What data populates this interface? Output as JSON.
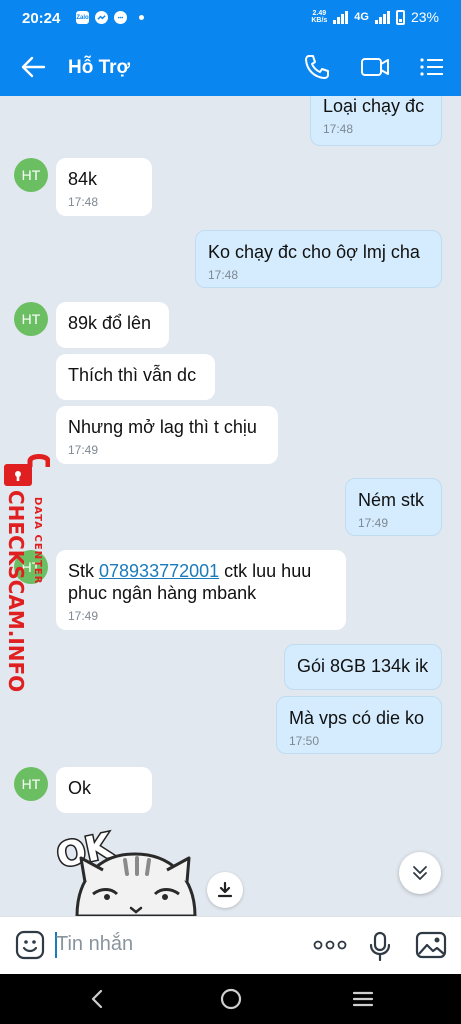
{
  "status_bar": {
    "time": "20:24",
    "notification_icons": [
      "zalo-icon",
      "messenger-icon",
      "chat-icon",
      "dot-icon"
    ],
    "net_speed_value": "2.49",
    "net_speed_unit": "KB/s",
    "network": "4G",
    "battery": "23%"
  },
  "header": {
    "title": "Hỗ Trợ",
    "actions": [
      "phone-icon",
      "video-call-icon",
      "menu-icon"
    ]
  },
  "messages": [
    {
      "dir": "out",
      "text": "Loại chạy đc",
      "time": "17:48"
    },
    {
      "dir": "in",
      "text": "84k",
      "time": "17:48",
      "avatar": "HT"
    },
    {
      "dir": "out",
      "text": "Ko chạy đc cho ôợ lmj cha",
      "time": "17:48"
    },
    {
      "dir": "in",
      "text": "89k đổ lên",
      "avatar": "HT"
    },
    {
      "dir": "in",
      "text": "Thích thì vẫn dc"
    },
    {
      "dir": "in",
      "text": "Nhưng mở lag thì t chịu",
      "time": "17:49"
    },
    {
      "dir": "out",
      "text": "Ném stk",
      "time": "17:49"
    },
    {
      "dir": "in",
      "text_prefix": "Stk ",
      "link": "078933772001",
      "text_suffix": " ctk luu huu",
      "text_line2": "phuc ngân hàng mbank",
      "time": "17:49",
      "avatar": "HT"
    },
    {
      "dir": "out",
      "text": "Gói 8GB 134k ik"
    },
    {
      "dir": "out",
      "text": "Mà vps có die ko",
      "time": "17:50"
    },
    {
      "dir": "in",
      "text": "Ok",
      "avatar": "HT"
    }
  ],
  "sticker": {
    "caption": "OK",
    "icon": "cat-sticker"
  },
  "watermark": {
    "brand": "CHECKSCAM.INFO",
    "sub": "DATA CENTER"
  },
  "composer": {
    "placeholder": "Tin nhắn"
  },
  "colors": {
    "accent": "#0a86f0",
    "outgoing_bubble": "#d4ecfd",
    "incoming_bubble": "#ffffff",
    "background": "#e2e8ef",
    "avatar": "#6bbf62",
    "link": "#1b7bbb"
  }
}
